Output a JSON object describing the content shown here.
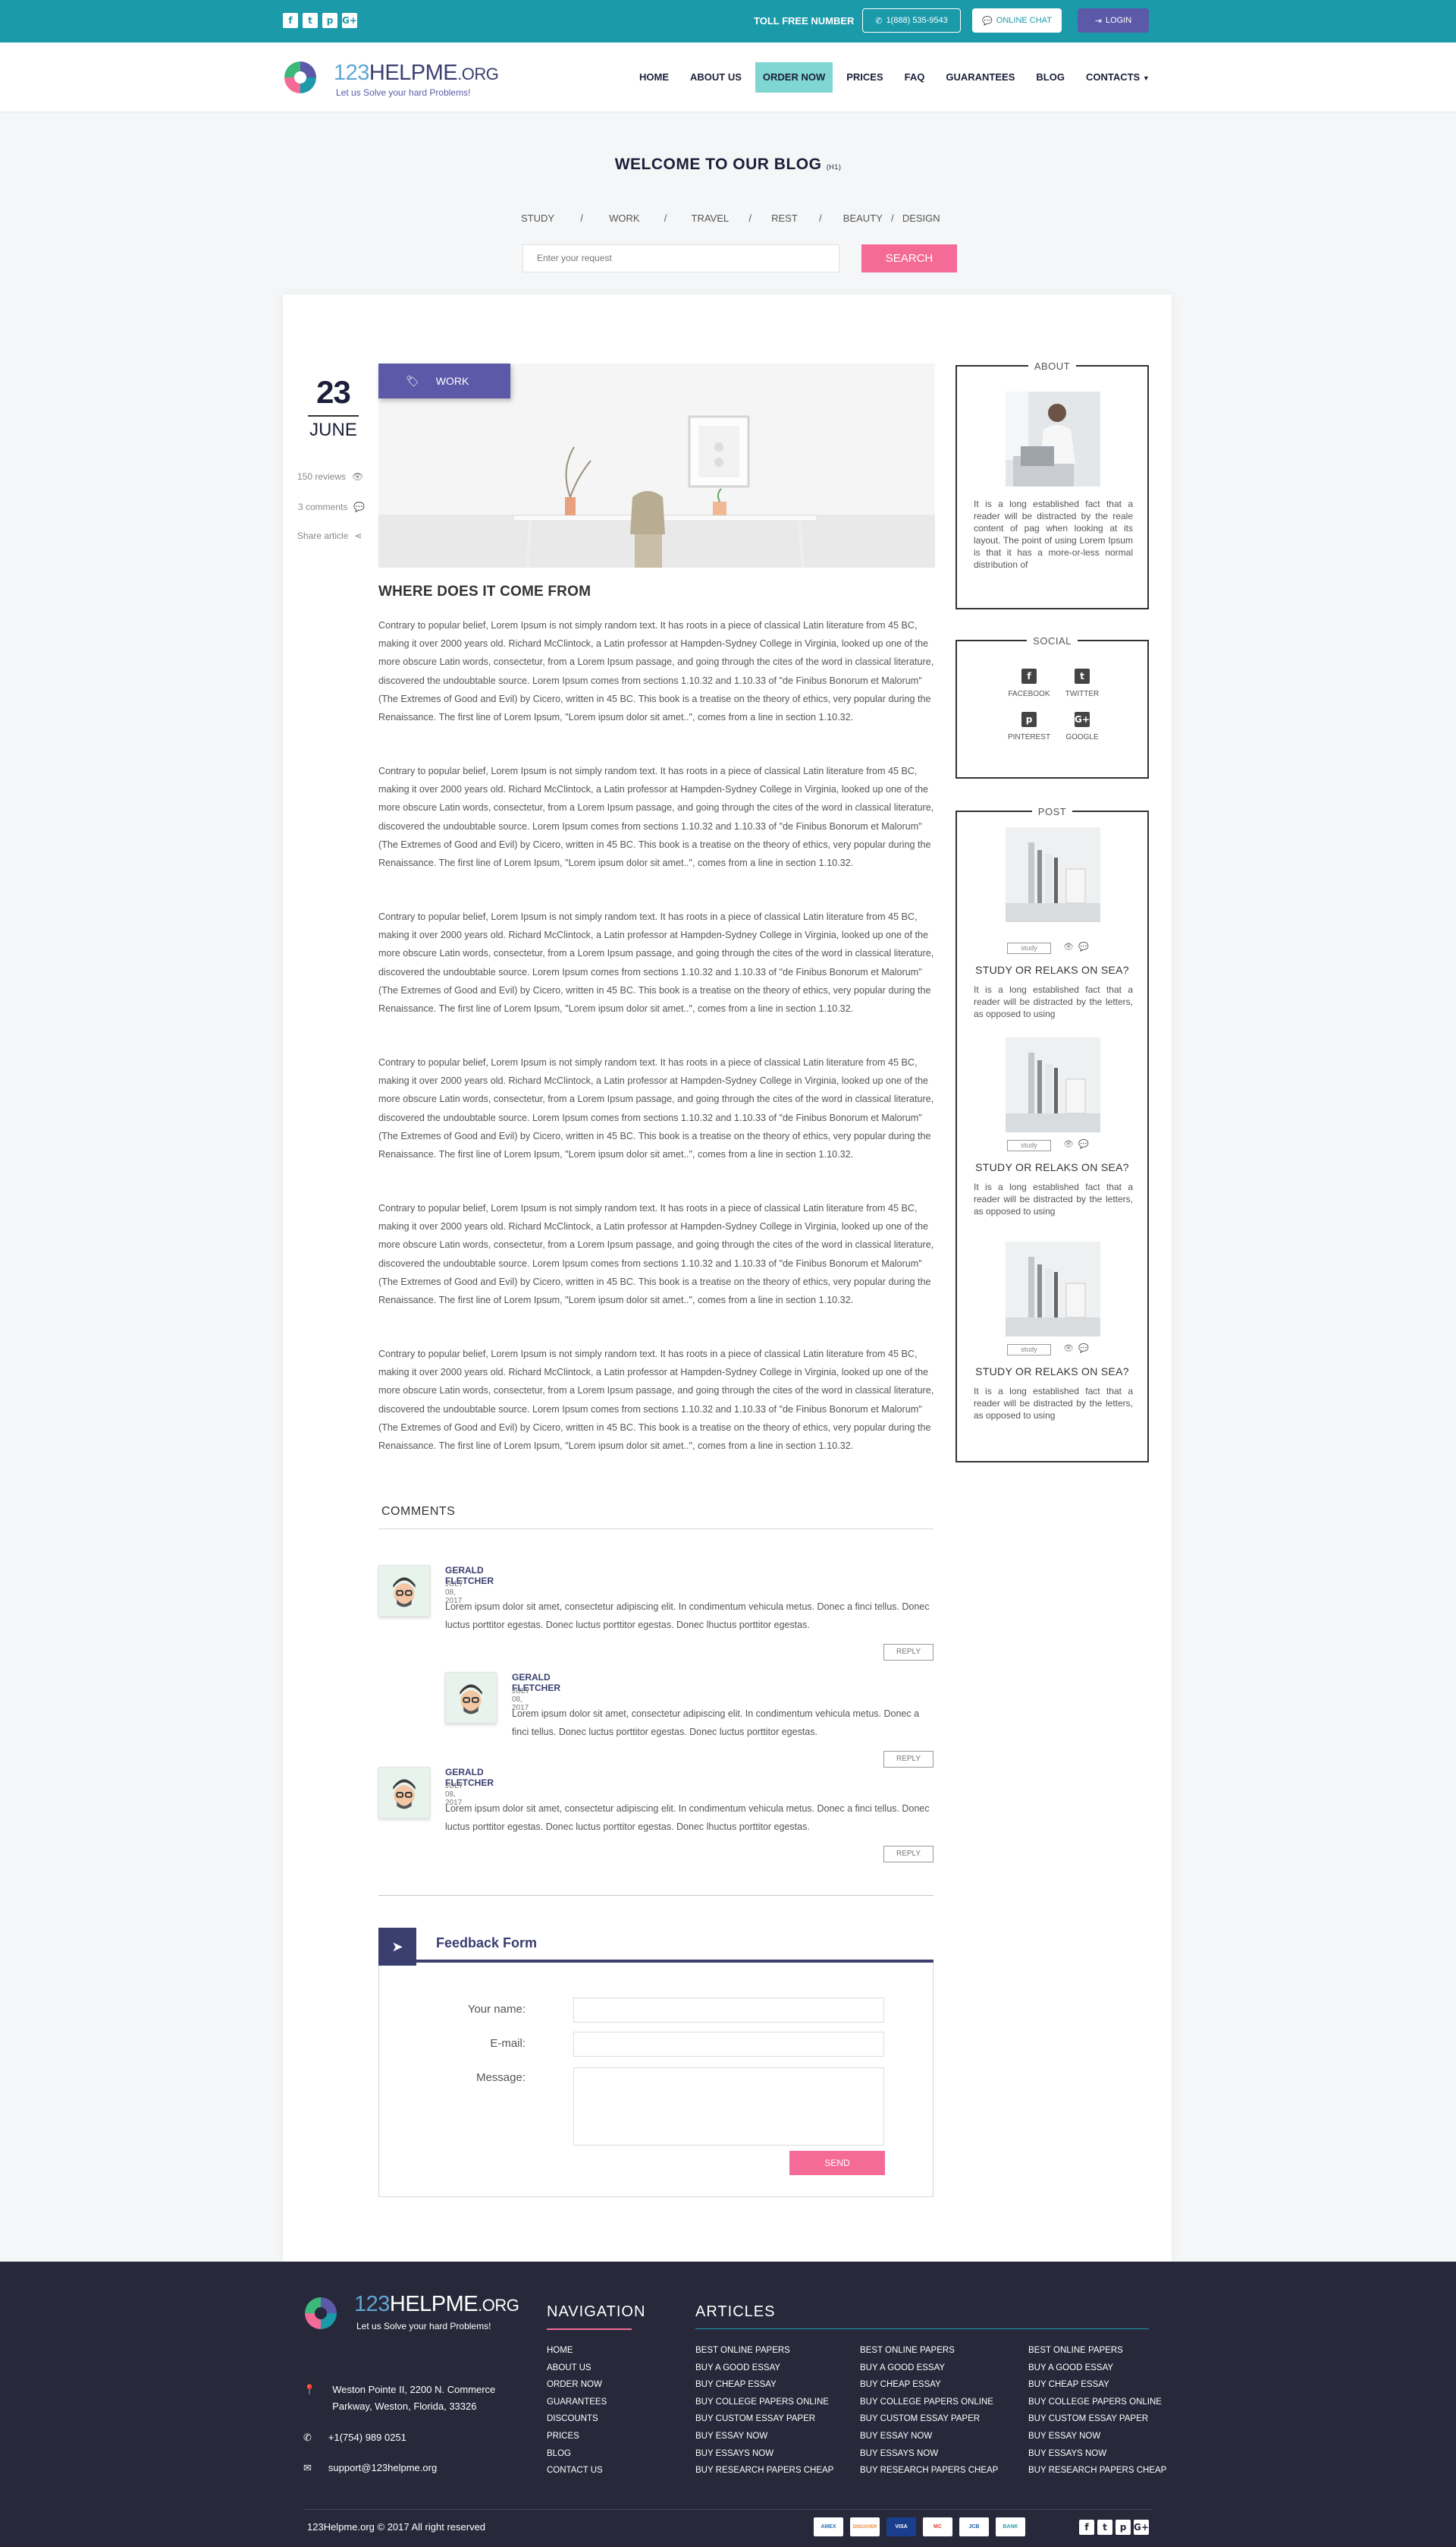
{
  "topbar": {
    "social": [
      "f",
      "t",
      "p",
      "G+"
    ],
    "toll_free": "TOLL FREE NUMBER",
    "phone": "1(888) 535-9543",
    "chat": "ONLINE CHAT",
    "login": "LOGIN"
  },
  "header": {
    "logo_main": "123",
    "logo_name": "HELPME",
    "logo_tld": ".ORG",
    "logo_tagline": "Let us Solve your hard Problems!",
    "nav": [
      {
        "label": "HOME"
      },
      {
        "label": "ABOUT US"
      },
      {
        "label": "ORDER NOW",
        "active": true
      },
      {
        "label": "PRICES"
      },
      {
        "label": "FAQ"
      },
      {
        "label": "GUARANTEES"
      },
      {
        "label": "BLOG"
      },
      {
        "label": "CONTACTS"
      }
    ]
  },
  "blog": {
    "title": "WELCOME TO OUR BLOG",
    "title_suffix": "(H1)",
    "categories": [
      "STUDY",
      "WORK",
      "TRAVEL",
      "REST",
      "BEAUTY",
      "DESIGN"
    ],
    "search_placeholder": "Enter your request",
    "search_button": "SEARCH"
  },
  "post": {
    "day": "23",
    "month": "JUNE",
    "reviews": "150 reviews",
    "comments": "3 comments",
    "share": "Share article",
    "tag": "WORK",
    "title": "WHERE DOES IT COME FROM",
    "paragraph": "Contrary to popular belief, Lorem Ipsum is not simply random text. It has roots in a piece of classical Latin literature from 45 BC, making it over 2000 years old. Richard McClintock, a Latin professor at Hampden-Sydney College in Virginia, looked up one of the more obscure Latin words, consectetur, from a Lorem Ipsum passage, and going through the cites of the word in classical literature, discovered the undoubtable source. Lorem Ipsum comes from sections 1.10.32 and 1.10.33 of \"de Finibus Bonorum et Malorum\" (The Extremes of Good and Evil) by Cicero, written in 45 BC. This book is a treatise on the theory of ethics, very popular during the Renaissance. The first line of Lorem Ipsum, \"Lorem ipsum dolor sit amet..\", comes from a line in section 1.10.32."
  },
  "comments": {
    "title": "COMMENTS",
    "items": [
      {
        "name": "GERALD FLETCHER",
        "date": "JULY 08, 2017",
        "text": "Lorem ipsum dolor sit amet, consectetur adipiscing elit. In condimentum vehicula metus. Donec a finci tellus. Donec luctus porttitor egestas.  Donec luctus porttitor egestas.  Donec lhuctus porttitor egestas.",
        "reply": "REPLY"
      },
      {
        "name": "GERALD FLETCHER",
        "date": "JULY 08, 2017",
        "text": "Lorem ipsum dolor sit amet, consectetur adipiscing elit. In condimentum vehicula metus. Donec a finci tellus. Donec luctus porttitor egestas.  Donec luctus porttitor egestas.",
        "reply": "REPLY"
      },
      {
        "name": "GERALD FLETCHER",
        "date": "JULY 08, 2017",
        "text": "Lorem ipsum dolor sit amet, consectetur adipiscing elit. In condimentum vehicula metus. Donec a finci tellus. Donec luctus porttitor egestas.  Donec luctus porttitor egestas.  Donec lhuctus porttitor egestas.",
        "reply": "REPLY"
      }
    ]
  },
  "feedback": {
    "title": "Feedback Form",
    "name_label": "Your name:",
    "email_label": "E-mail:",
    "message_label": "Message:",
    "send": "SEND"
  },
  "sidebar": {
    "about_title": "ABOUT",
    "about_text": "It is a long established fact that a reader will be distracted by the reale content of pag when looking at its layout. The point of using Lorem Ipsum is that it has a more-or-less normal distribution of",
    "social_title": "SOCIAL",
    "social": [
      {
        "icon": "f",
        "label": "FACEBOOK"
      },
      {
        "icon": "t",
        "label": "TWITTER"
      },
      {
        "icon": "p",
        "label": "PINTEREST"
      },
      {
        "icon": "G+",
        "label": "GOOGLE"
      }
    ],
    "post_title": "POST",
    "posts": [
      {
        "tag": "study",
        "title": "STUDY OR RELAKS ON SEA?",
        "text": "It is a long established fact that a reader will be distracted by the letters, as opposed to using"
      },
      {
        "tag": "study",
        "title": "STUDY OR RELAKS ON SEA?",
        "text": "It is a long established fact that a reader will be distracted by the letters, as opposed to using"
      },
      {
        "tag": "study",
        "title": "STUDY OR RELAKS ON SEA?",
        "text": "It is a long established fact that a reader will be distracted by the letters, as opposed to using"
      }
    ]
  },
  "footer": {
    "address": "Weston Pointe II, 2200 N. Commerce Parkway, Weston, Florida, 33326",
    "phone": "+1(754) 989 0251",
    "email": "support@123helpme.org",
    "nav_title": "NAVIGATION",
    "nav": [
      "HOME",
      "ABOUT US",
      "ORDER NOW",
      "GUARANTEES",
      "DISCOUNTS",
      "PRICES",
      "BLOG",
      "CONTACT US"
    ],
    "articles_title": "ARTICLES",
    "articles": [
      "BEST ONLINE PAPERS",
      "BUY A GOOD ESSAY",
      "BUY CHEAP ESSAY",
      "BUY COLLEGE PAPERS ONLINE",
      "BUY CUSTOM ESSAY PAPER",
      "BUY ESSAY NOW",
      "BUY ESSAYS NOW",
      "BUY RESEARCH PAPERS CHEAP"
    ],
    "copyright": "123Helpme.org  ©  2017 All right reserved",
    "payment_cards": [
      "AMEX",
      "DISCOVER",
      "VISA",
      "MC",
      "JCB",
      "BANK"
    ],
    "social": [
      "f",
      "t",
      "p",
      "G+"
    ]
  },
  "colors": {
    "teal": "#1b9aaa",
    "purple": "#5b59a8",
    "navy": "#3a3f70",
    "pink": "#f56b97",
    "footer": "#27283a"
  }
}
